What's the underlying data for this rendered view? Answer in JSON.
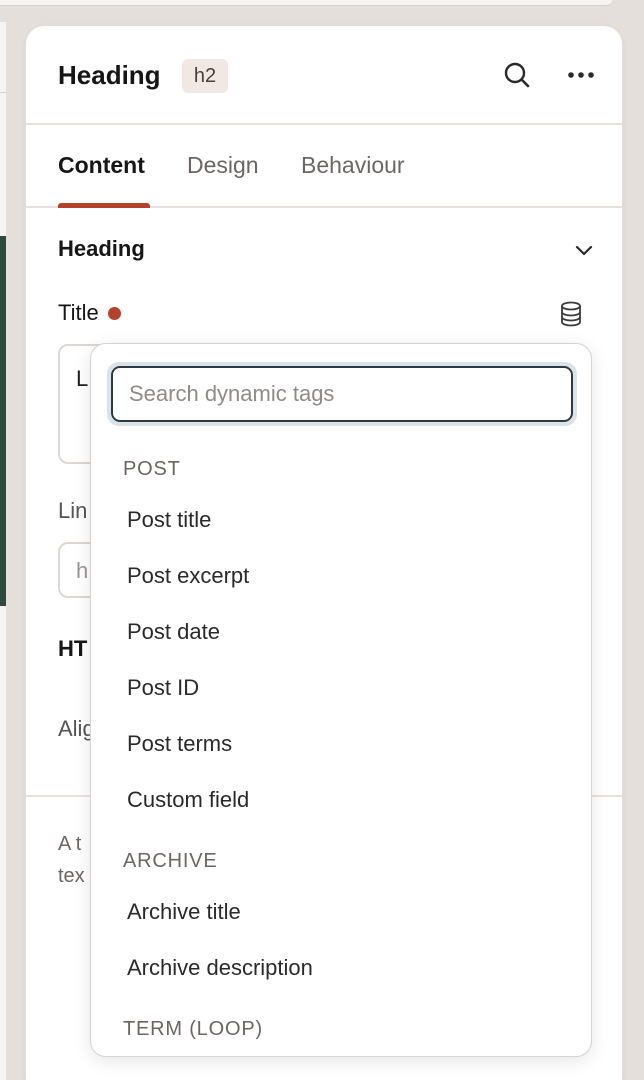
{
  "panel": {
    "title": "Heading",
    "tag": "h2"
  },
  "tabs": [
    {
      "label": "Content",
      "active": true
    },
    {
      "label": "Design",
      "active": false
    },
    {
      "label": "Behaviour",
      "active": false
    }
  ],
  "section": {
    "title": "Heading"
  },
  "fields": {
    "title_label": "Title",
    "title_value": "L",
    "link_label": "Lin",
    "link_value": "h",
    "html_label": "HT",
    "align_label": "Alig"
  },
  "help": {
    "line1": "A t",
    "line2": "tex"
  },
  "dropdown": {
    "search_placeholder": "Search dynamic tags",
    "groups": [
      {
        "label": "POST",
        "items": [
          "Post title",
          "Post excerpt",
          "Post date",
          "Post ID",
          "Post terms",
          "Custom field"
        ]
      },
      {
        "label": "ARCHIVE",
        "items": [
          "Archive title",
          "Archive description"
        ]
      },
      {
        "label": "TERM (LOOP)",
        "items": []
      }
    ]
  },
  "colors": {
    "accent": "#b3412c",
    "focus": "#2f3a40",
    "canvas_dark": "#2e4a3d"
  }
}
